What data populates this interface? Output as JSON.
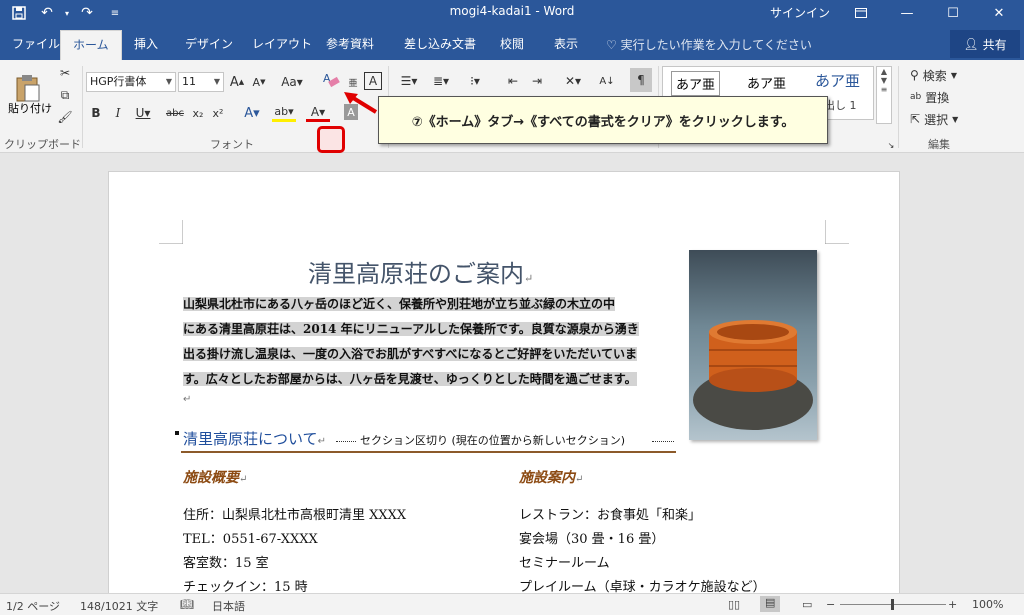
{
  "window": {
    "title": "mogi4-kadai1  -  Word",
    "signin": "サインイン"
  },
  "tabs": [
    "ファイル",
    "ホーム",
    "挿入",
    "デザイン",
    "レイアウト",
    "参考資料",
    "差し込み文書",
    "校閲",
    "表示"
  ],
  "tellme": "実行したい作業を入力してください",
  "share": "共有",
  "ribbon": {
    "clipboard": {
      "paste": "貼り付け",
      "label": "クリップボード"
    },
    "font": {
      "name": "HGP行書体",
      "size": "11",
      "label": "フォント"
    },
    "styles": {
      "items": [
        "あア亜",
        "あア亜",
        "あア亜"
      ],
      "heading1": "見出し 1"
    },
    "editing": {
      "find": "検索",
      "replace": "置換",
      "select": "選択",
      "label": "編集"
    }
  },
  "callout": "⑦《ホーム》タブ→《すべての書式をクリア》をクリックします。",
  "document": {
    "title": "清里高原荘のご案内",
    "paragraph_lines": [
      "山梨県北杜市にある八ヶ岳のほど近く、保養所や別荘地が立ち並ぶ緑の木立の中",
      "にある清里高原荘は、2014 年にリニューアルした保養所です。良質な源泉から湧き",
      "出る掛け流し温泉は、一度の入浴でお肌がすべすべになるとご好評をいただいていま",
      "す。広々としたお部屋からは、八ヶ岳を見渡せ、ゆっくりとした時間を過ごせます。"
    ],
    "section_heading": "清里高原荘について",
    "section_break": "セクション区切り (現在の位置から新しいセクション)",
    "left_heading": "施設概要",
    "right_heading": "施設案内",
    "left_items": [
      "住所：山梨県北杜市高根町清里 XXXX",
      "TEL：0551-67-XXXX",
      "客室数：15 室",
      "チェックイン：15 時"
    ],
    "right_items": [
      "レストラン：お食事処「和楽」",
      "宴会場（30 畳・16 畳）",
      "セミナールーム",
      "プレイルーム（卓球・カラオケ施設など）"
    ]
  },
  "status": {
    "page": "1/2 ページ",
    "words": "148/1021 文字",
    "language": "日本語",
    "zoom": "100%"
  },
  "colors": {
    "accent": "#2b579a",
    "highlight": "#e00000",
    "section_line": "#8c5a2a"
  }
}
